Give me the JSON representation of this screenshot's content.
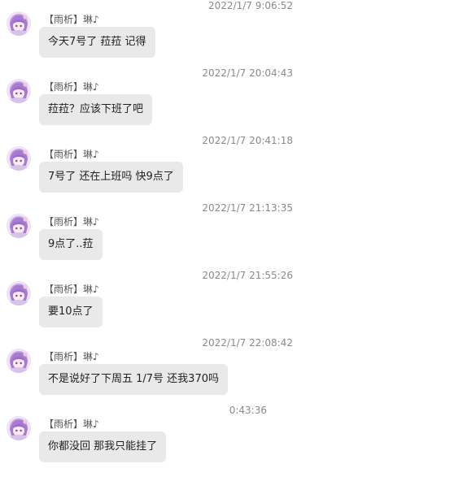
{
  "colors": {
    "bubble_bg": "#e9e9e9",
    "timestamp": "#8a8a8a",
    "sender": "#555555",
    "text": "#222222",
    "avatar_accent": "#b58ad6"
  },
  "messages": [
    {
      "timestamp": "2022/1/7 9:06:52",
      "sender": "【雨析】琳♪",
      "avatar_icon": "anime-avatar-icon",
      "text": "今天7号了 菈菈 记得"
    },
    {
      "timestamp": "2022/1/7 20:04:43",
      "sender": "【雨析】琳♪",
      "avatar_icon": "anime-avatar-icon",
      "text": "菈菈？应该下班了吧"
    },
    {
      "timestamp": "2022/1/7 20:41:18",
      "sender": "【雨析】琳♪",
      "avatar_icon": "anime-avatar-icon",
      "text": "7号了 还在上班吗 快9点了"
    },
    {
      "timestamp": "2022/1/7 21:13:35",
      "sender": "【雨析】琳♪",
      "avatar_icon": "anime-avatar-icon",
      "text": "9点了..菈"
    },
    {
      "timestamp": "2022/1/7 21:55:26",
      "sender": "【雨析】琳♪",
      "avatar_icon": "anime-avatar-icon",
      "text": "要10点了"
    },
    {
      "timestamp": "2022/1/7 22:08:42",
      "sender": "【雨析】琳♪",
      "avatar_icon": "anime-avatar-icon",
      "text": "不是说好了下周五 1/7号 还我370吗"
    },
    {
      "timestamp": "0:43:36",
      "sender": "【雨析】琳♪",
      "avatar_icon": "anime-avatar-icon",
      "text": "你都没回 那我只能挂了"
    }
  ]
}
